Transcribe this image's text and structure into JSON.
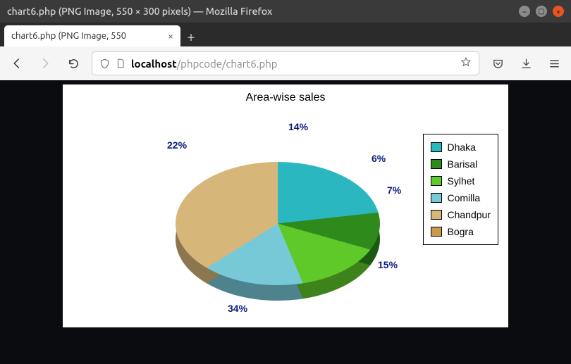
{
  "window": {
    "title": "chart6.php (PNG Image, 550 × 300 pixels) — Mozilla Firefox"
  },
  "tab": {
    "label": "chart6.php (PNG Image, 550"
  },
  "address": {
    "host": "localhost",
    "path": "/phpcode/chart6.php"
  },
  "chart_data": {
    "type": "pie",
    "title": "Area-wise sales",
    "series": [
      {
        "name": "Dhaka",
        "value": 7,
        "color": "#2ab7c0",
        "pct_label": "7%"
      },
      {
        "name": "Barisal",
        "value": 6,
        "color": "#2e8b1b",
        "pct_label": "6%"
      },
      {
        "name": "Sylhet",
        "value": 14,
        "color": "#5fc92a",
        "pct_label": "14%"
      },
      {
        "name": "Comilla",
        "value": 22,
        "color": "#78c9d8",
        "pct_label": "22%"
      },
      {
        "name": "Chandpur",
        "value": 34,
        "color": "#d7b67a",
        "pct_label": "34%"
      },
      {
        "name": "Bogra",
        "value": 15,
        "color": "#c89a4a",
        "pct_label": "15%"
      }
    ]
  }
}
